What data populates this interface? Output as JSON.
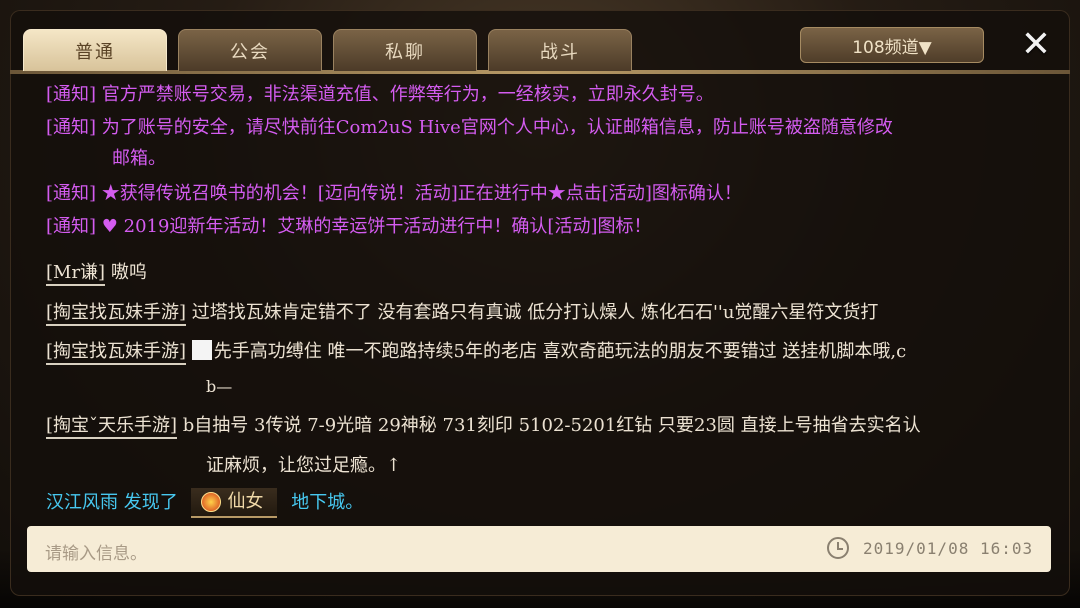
{
  "tabs": [
    {
      "label": "普通",
      "active": true
    },
    {
      "label": "公会",
      "active": false
    },
    {
      "label": "私聊",
      "active": false
    },
    {
      "label": "战斗",
      "active": false
    }
  ],
  "channel_label": "108频道▼",
  "close_icon": "close-icon",
  "notices": [
    "[通知] 官方严禁账号交易，非法渠道充值、作弊等行为，一经核实，立即永久封号。",
    "[通知] 为了账号的安全，请尽快前往Com2uS Hive官网个人中心，认证邮箱信息，防止账号被盗随意修改",
    "邮箱。",
    "[通知] ★获得传说召唤书的机会！[迈向传说！活动]正在进行中★点击[活动]图标确认！",
    "[通知] ♥ 2019迎新年活动！艾琳的幸运饼干活动进行中！确认[活动]图标！"
  ],
  "chats": [
    {
      "sender": "[Mr谦]",
      "text": "嗷呜"
    },
    {
      "sender": "[掏宝找瓦妹手游]",
      "text": "过塔找瓦妹肯定错不了 没有套路只有真诚 低分打认燥人 炼化石石''u觉醒六星符文货打"
    },
    {
      "sender": "[掏宝找瓦妹手游]",
      "text": "先手高功缚住 唯一不跑路持续5年的老店  喜欢奇葩玩法的朋友不要错过  送挂机脚本哦,c",
      "cont": "b—"
    },
    {
      "sender": "[掏宝ˇ天乐手游]",
      "text": "b自抽号 3传说 7-9光暗 29神秘 731刻印 5102-5201红钻 只要23圆  直接上号抽省去实名认",
      "cont": "证麻烦，让您过足瘾。↑"
    }
  ],
  "system": {
    "player": "汉江风雨",
    "verb": "发现了",
    "item": "仙女",
    "place": "地下城。"
  },
  "input": {
    "placeholder": "请输入信息。",
    "timestamp": "2019/01/08  16:03"
  },
  "colors": {
    "notice": "#d45cf0",
    "system": "#47c8f0",
    "tab_active": "#f4e6c6",
    "input_bg": "#f6ecd6"
  }
}
